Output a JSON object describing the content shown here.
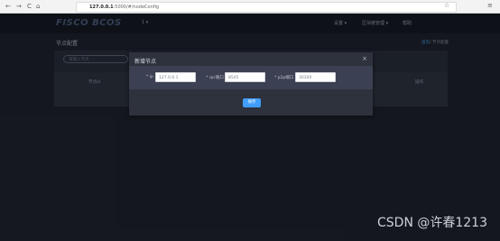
{
  "browser": {
    "back": "←",
    "forward": "→",
    "reload": "C",
    "home": "⌂",
    "url_host": "127.0.0.1",
    "url_path": ":5000/#/nodeConfig",
    "star": "☆",
    "menu": "≡"
  },
  "header": {
    "logo": "FISCO BCOS",
    "group_select": "1 ▾",
    "menu_items": [
      "设置 ▾",
      "区块链管理 ▾",
      "帮助"
    ]
  },
  "page": {
    "title": "节点配置",
    "breadcrumb_link": "首页",
    "breadcrumb_current": "/ 节点配置",
    "search_placeholder": "请输入节点",
    "table_headers": [
      "节点id",
      "操作"
    ]
  },
  "dialog": {
    "title": "新增节点",
    "close": "×",
    "fields": [
      {
        "label": "* ip",
        "value": "127.0.0.1"
      },
      {
        "label": "* rpc端口",
        "value": "8545"
      },
      {
        "label": "* p2p端口",
        "value": "30300"
      }
    ],
    "save_label": "保存"
  },
  "watermark": "CSDN @许春1213"
}
